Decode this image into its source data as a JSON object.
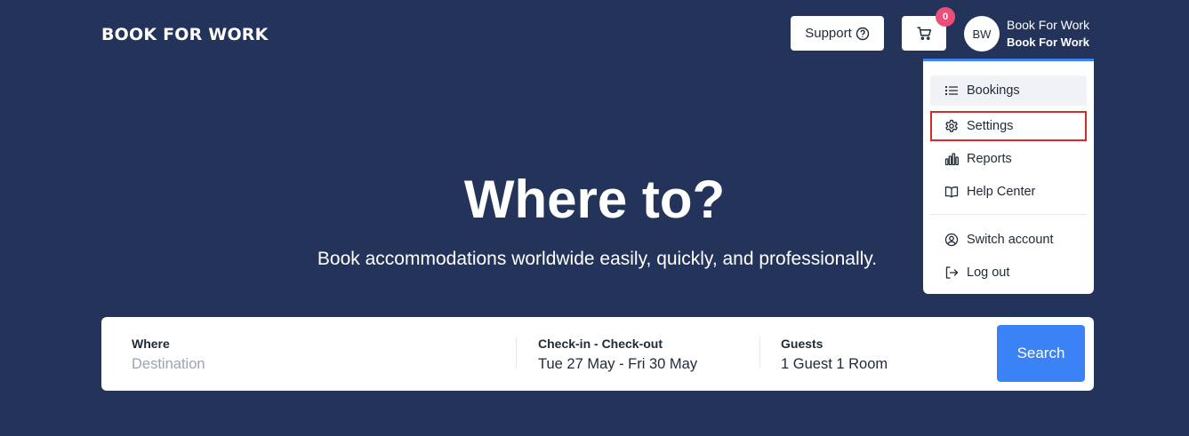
{
  "header": {
    "logo_text": "BOOK FOR WORK",
    "support_label": "Support",
    "cart_count": "0",
    "avatar_initials": "BW",
    "user_name": "Book For Work",
    "user_company": "Book For Work"
  },
  "menu": {
    "items": [
      {
        "label": "Bookings",
        "icon": "list-icon"
      },
      {
        "label": "Settings",
        "icon": "gear-icon"
      },
      {
        "label": "Reports",
        "icon": "bar-chart-icon"
      },
      {
        "label": "Help Center",
        "icon": "book-open-icon"
      },
      {
        "label": "Switch account",
        "icon": "user-circle-icon"
      },
      {
        "label": "Log out",
        "icon": "logout-icon"
      }
    ]
  },
  "hero": {
    "title": "Where to?",
    "subtitle": "Book accommodations worldwide easily, quickly, and professionally."
  },
  "search": {
    "where_label": "Where",
    "where_placeholder": "Destination",
    "dates_label": "Check-in - Check-out",
    "dates_value": "Tue 27 May - Fri 30 May",
    "guests_label": "Guests",
    "guests_value": "1 Guest 1 Room",
    "button_label": "Search"
  },
  "colors": {
    "background": "#24335a",
    "accent": "#3b82f6",
    "badge": "#ec4e7a",
    "highlight_border": "#d62b2b"
  }
}
